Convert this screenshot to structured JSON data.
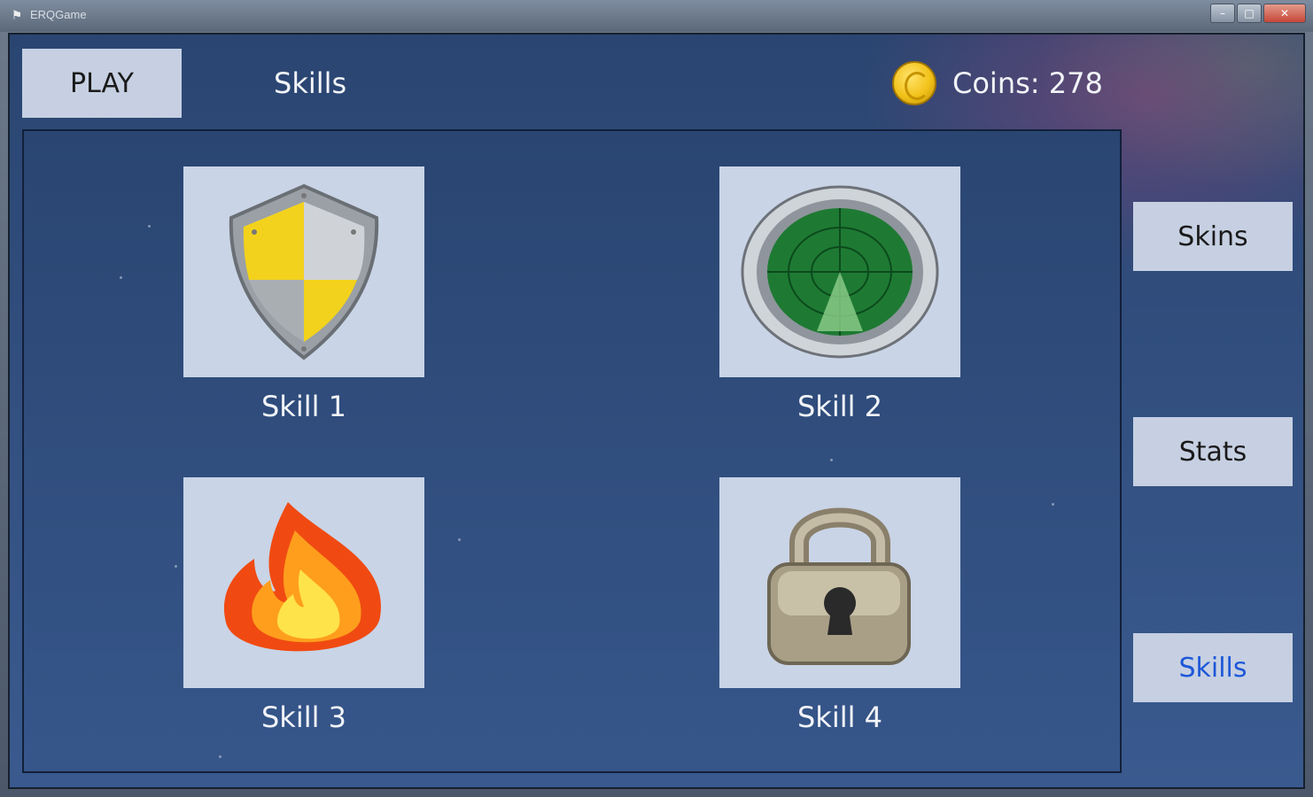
{
  "window": {
    "title": "ERQGame",
    "buttons": [
      "–",
      "□",
      "✕"
    ]
  },
  "header": {
    "play_label": "PLAY",
    "section_title": "Skills",
    "coins_label": "Coins: 278"
  },
  "skills": [
    {
      "label": "Skill 1",
      "icon": "shield-icon"
    },
    {
      "label": "Skill 2",
      "icon": "radar-icon"
    },
    {
      "label": "Skill 3",
      "icon": "fire-icon"
    },
    {
      "label": "Skill 4",
      "icon": "lock-icon"
    }
  ],
  "sidebar": {
    "skins_label": "Skins",
    "stats_label": "Stats",
    "skills_label": "Skills",
    "active": "Skills"
  },
  "colors": {
    "background": "#2a4571",
    "tile": "#c9d4e6",
    "active_text": "#1d57d8",
    "coin": "#f2c21a"
  }
}
